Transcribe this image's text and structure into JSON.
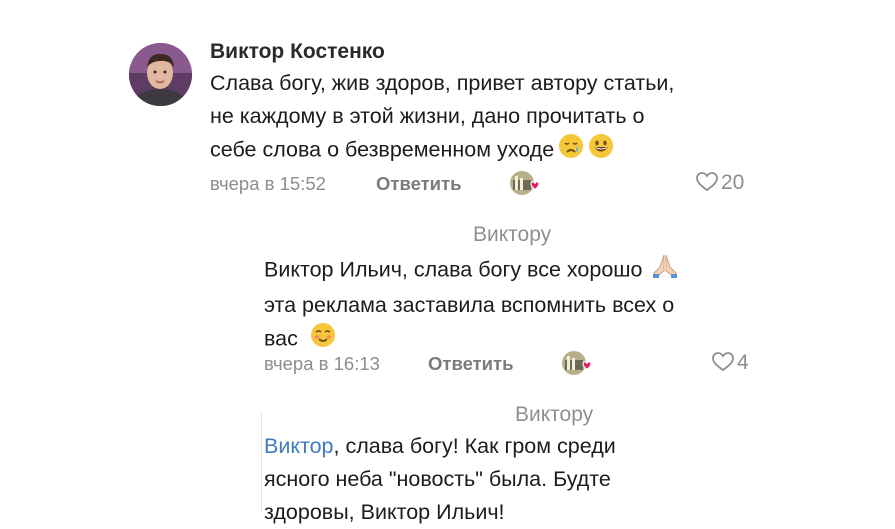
{
  "comment1": {
    "author": "Виктор Костенко",
    "lines": [
      "Слава богу, жив здоров, привет автору статьи,",
      "не каждому в этой жизни, дано прочитать о",
      "себе слова о безвременном уходе"
    ],
    "time": "вчера в 15:52",
    "reply_label": "Ответить",
    "likes": "20"
  },
  "reply1": {
    "reply_to": "Виктору",
    "lines": [
      "Виктор Ильич, слава богу все хорошо",
      "эта реклама заставила вспомнить всех о",
      "вас"
    ],
    "time": "вчера в 16:13",
    "reply_label": "Ответить",
    "likes": "4"
  },
  "reply2": {
    "reply_to": "Виктору",
    "mention": "Виктор",
    "line1_rest": ", слава богу! Как гром среди",
    "line2": "ясного неба \"новость\" была. Будте",
    "line3": "здоровы, Виктор Ильич!"
  },
  "icons": {
    "crying": "crying-face-icon",
    "grin": "grinning-face-icon",
    "pray": "folded-hands-icon",
    "smile": "smiling-face-icon",
    "heart": "heart-outline-icon"
  },
  "colors": {
    "mention": "#3f7bbf",
    "reaction_heart": "#e0245e",
    "meta": "#8d8d8d"
  }
}
